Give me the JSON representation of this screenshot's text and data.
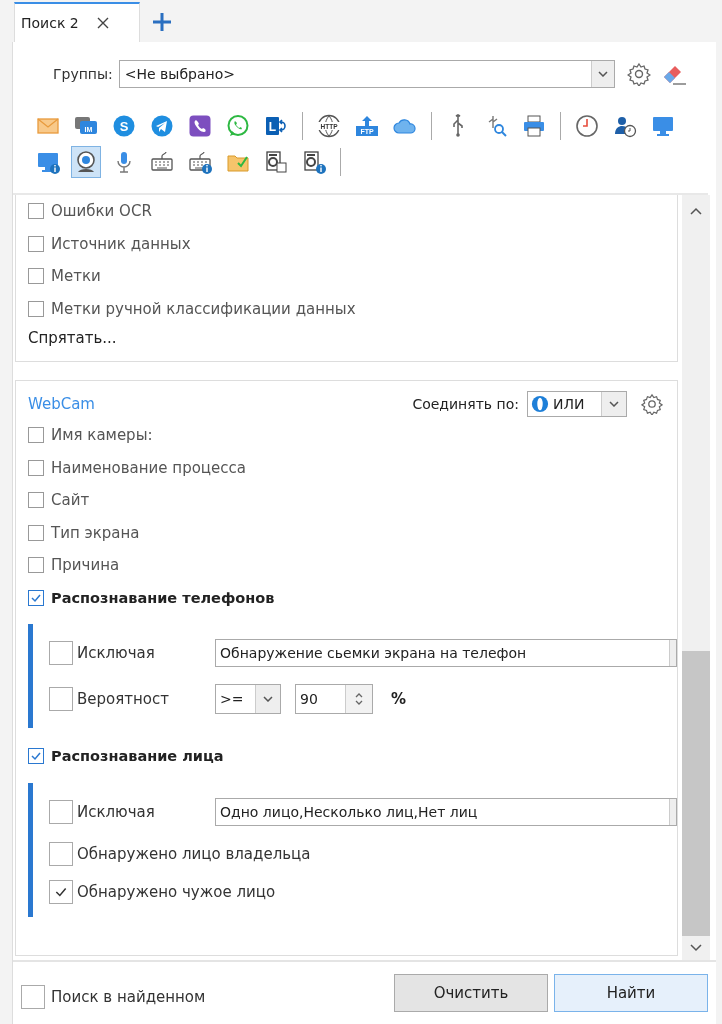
{
  "tab": {
    "title": "Поиск 2",
    "selected": true
  },
  "groups": {
    "label": "Группы:",
    "value": "<Не выбрано>"
  },
  "toolbar": [
    {
      "kind": "mail",
      "selected": false
    },
    {
      "kind": "im",
      "label": "IM",
      "selected": false
    },
    {
      "kind": "skype",
      "label": "S",
      "selected": false
    },
    {
      "kind": "telegram",
      "selected": false
    },
    {
      "kind": "viber",
      "selected": false
    },
    {
      "kind": "whatsapp",
      "selected": false
    },
    {
      "kind": "lync",
      "label": "L",
      "selected": false
    },
    {
      "kind": "separator"
    },
    {
      "kind": "http",
      "label": "HTTP",
      "selected": false
    },
    {
      "kind": "ftp",
      "label": "FTP",
      "selected": false
    },
    {
      "kind": "cloud",
      "selected": false
    },
    {
      "kind": "separator"
    },
    {
      "kind": "usb",
      "selected": false
    },
    {
      "kind": "device-search",
      "selected": false
    },
    {
      "kind": "printer",
      "selected": false
    },
    {
      "kind": "separator"
    },
    {
      "kind": "clock",
      "selected": false
    },
    {
      "kind": "user-clock",
      "selected": false
    },
    {
      "kind": "monitor",
      "selected": false
    },
    {
      "kind": "break"
    },
    {
      "kind": "monitor-info",
      "selected": false
    },
    {
      "kind": "webcam",
      "selected": true
    },
    {
      "kind": "microphone",
      "selected": false
    },
    {
      "kind": "keyboard",
      "selected": false
    },
    {
      "kind": "keyboard-info",
      "selected": false
    },
    {
      "kind": "folder",
      "selected": false
    },
    {
      "kind": "document",
      "selected": false
    },
    {
      "kind": "document-info",
      "selected": false
    },
    {
      "kind": "separator"
    }
  ],
  "fields_panel": {
    "items": [
      {
        "label": "Ошибки OCR",
        "checked": false
      },
      {
        "label": "Источник данных",
        "checked": false
      },
      {
        "label": "Метки",
        "checked": false
      },
      {
        "label": "Метки ручной классификации данных",
        "checked": false
      }
    ],
    "hide_link": "Спрятать..."
  },
  "webcam_panel": {
    "title": "WebCam",
    "join_label": "Соединять по:",
    "join_value": "ИЛИ",
    "items": [
      {
        "kind": "checkbox",
        "label": "Имя камеры:",
        "checked": false
      },
      {
        "kind": "checkbox",
        "label": "Наименование процесса",
        "checked": false
      },
      {
        "kind": "checkbox",
        "label": "Сайт",
        "checked": false
      },
      {
        "kind": "checkbox",
        "label": "Тип экрана",
        "checked": false
      },
      {
        "kind": "checkbox",
        "label": "Причина",
        "checked": false
      },
      {
        "kind": "group",
        "label": "Распознавание телефонов",
        "checked": true,
        "children": [
          {
            "kind": "exclude",
            "label": "Исключая",
            "checked": false,
            "value": "Обнаружение сьемки экрана на телефон"
          },
          {
            "kind": "probability",
            "label": "Вероятност",
            "checked": false,
            "operator": ">=",
            "value": "90",
            "unit": "%"
          }
        ]
      },
      {
        "kind": "group",
        "label": "Распознавание лица",
        "checked": true,
        "children": [
          {
            "kind": "exclude",
            "label": "Исключая",
            "checked": false,
            "value": "Одно лицо,Несколько лиц,Нет лиц"
          },
          {
            "kind": "checkbox",
            "label": "Обнаружено лицо владельца",
            "checked": false
          },
          {
            "kind": "checkbox",
            "label": "Обнаружено чужое лицо",
            "checked": true
          }
        ]
      }
    ]
  },
  "footer": {
    "search_in_found": {
      "label": "Поиск в найденном",
      "checked": false
    },
    "buttons": [
      {
        "label": "Очистить",
        "default": false
      },
      {
        "label": "Найти",
        "default": true
      }
    ]
  }
}
